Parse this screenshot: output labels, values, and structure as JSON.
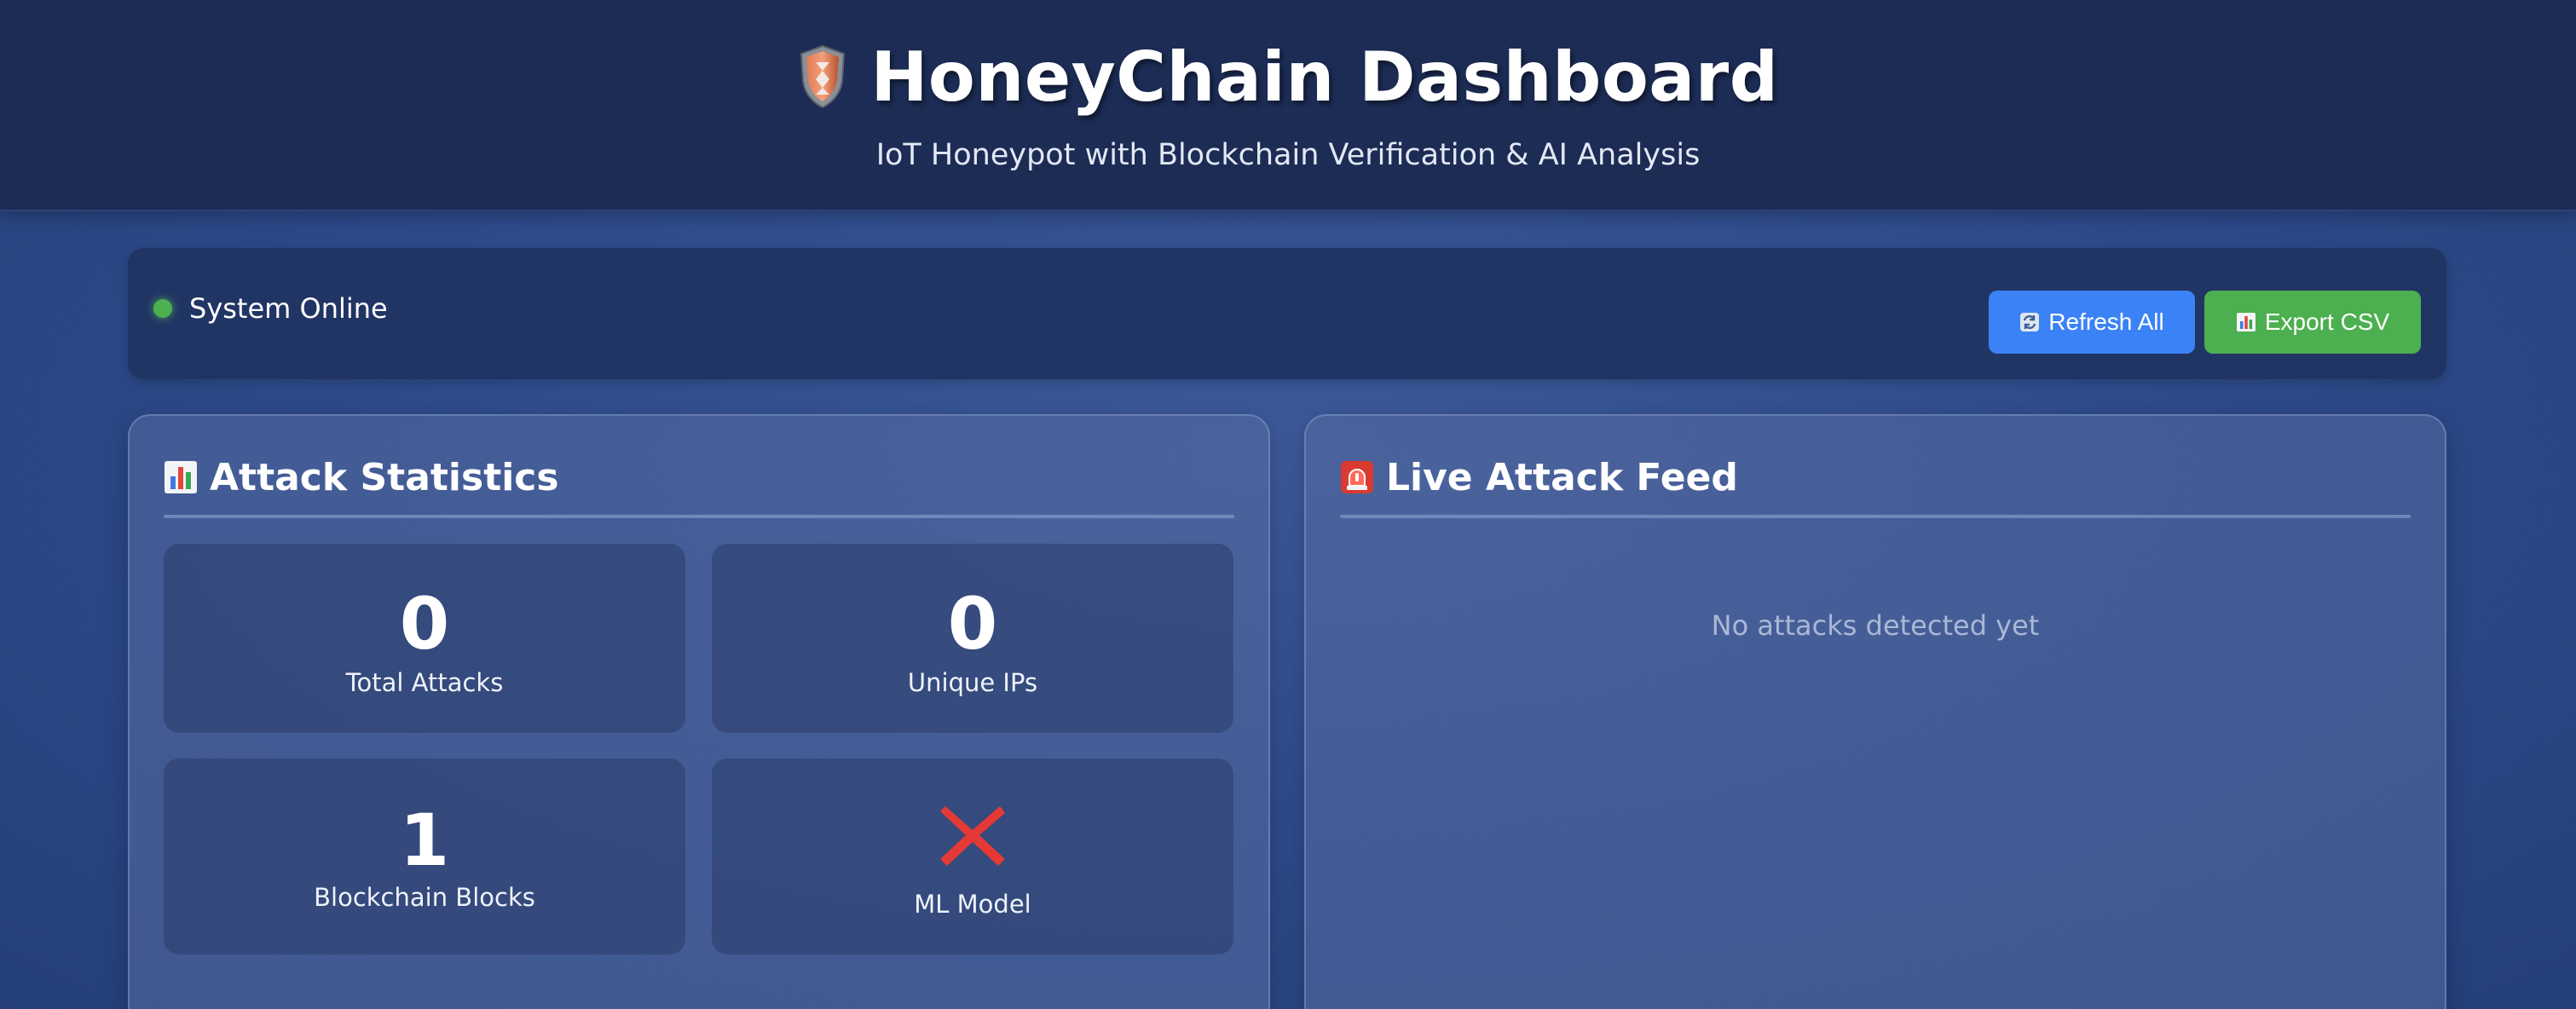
{
  "header": {
    "title": "HoneyChain Dashboard",
    "subtitle": "IoT Honeypot with Blockchain Verification & AI Analysis",
    "icon": "shield-icon"
  },
  "status": {
    "text": "System Online",
    "color": "#4caf50"
  },
  "actions": {
    "refresh_label": "Refresh All",
    "refresh_icon": "refresh-icon",
    "export_label": "Export CSV",
    "export_icon": "bar-chart-icon",
    "refresh_color": "#3b82f6",
    "export_color": "#4caf50"
  },
  "stats_panel": {
    "title": "Attack Statistics",
    "icon": "bar-chart-icon",
    "cards": [
      {
        "value": "0",
        "label": "Total Attacks"
      },
      {
        "value": "0",
        "label": "Unique IPs"
      },
      {
        "value": "1",
        "label": "Blockchain Blocks"
      },
      {
        "icon": "cross-icon",
        "label": "ML Model",
        "icon_color": "#e53935"
      }
    ]
  },
  "feed_panel": {
    "title": "Live Attack Feed",
    "icon": "siren-icon",
    "empty_text": "No attacks detected yet"
  }
}
